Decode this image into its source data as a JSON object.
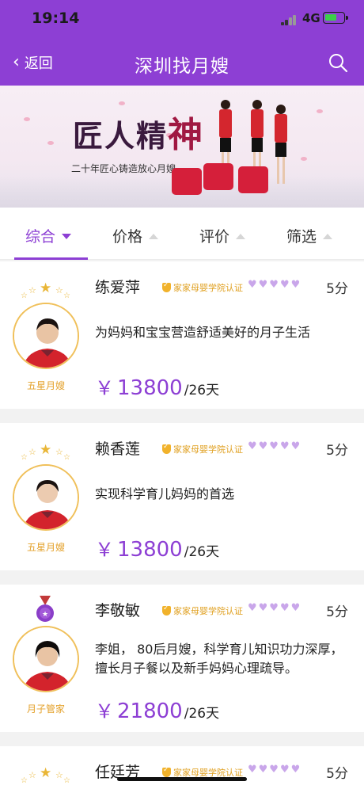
{
  "status_bar": {
    "time": "19:14",
    "network": "4G"
  },
  "nav": {
    "back_label": "返回",
    "title": "深圳找月嫂"
  },
  "banner": {
    "title_part1": "匠人精",
    "title_part2": "神",
    "subtitle": "二十年匠心铸造放心月嫂"
  },
  "tabs": [
    {
      "label": "综合",
      "active": true
    },
    {
      "label": "价格",
      "active": false
    },
    {
      "label": "评价",
      "active": false
    },
    {
      "label": "筛选",
      "active": false
    }
  ],
  "nannies": [
    {
      "name": "练爱萍",
      "certification": "家家母婴学院认证",
      "hearts": 5,
      "score": "5分",
      "level": "五星月嫂",
      "description": "为妈妈和宝宝营造舒适美好的月子生活",
      "currency": "￥",
      "price": "13800",
      "unit": "/26天",
      "badge": "stars"
    },
    {
      "name": "赖香莲",
      "certification": "家家母婴学院认证",
      "hearts": 5,
      "score": "5分",
      "level": "五星月嫂",
      "description": "实现科学育儿妈妈的首选",
      "currency": "￥",
      "price": "13800",
      "unit": "/26天",
      "badge": "stars"
    },
    {
      "name": "李敬敏",
      "certification": "家家母婴学院认证",
      "hearts": 5,
      "score": "5分",
      "level": "月子管家",
      "description": "李姐， 80后月嫂，科学育儿知识功力深厚，擅长月子餐以及新手妈妈心理疏导。",
      "currency": "￥",
      "price": "21800",
      "unit": "/26天",
      "badge": "medal"
    },
    {
      "name": "任廷芳",
      "certification": "家家母婴学院认证",
      "hearts": 5,
      "score": "5分",
      "level": "",
      "description": "",
      "currency": "",
      "price": "",
      "unit": "",
      "badge": "stars"
    }
  ],
  "colors": {
    "accent": "#8d3fd4",
    "gold": "#e4a12a",
    "heart": "#c9a6ea"
  }
}
